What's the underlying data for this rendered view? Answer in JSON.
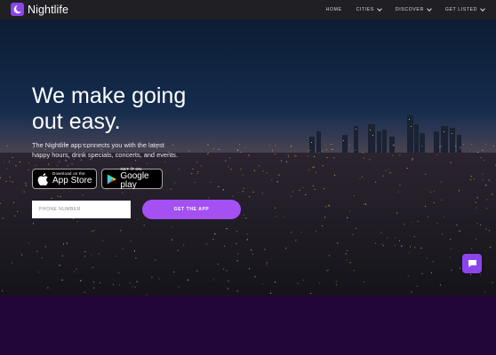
{
  "nav": {
    "brand": "Nightlife",
    "links": [
      {
        "label": "HOME",
        "dropdown": false
      },
      {
        "label": "CITIES",
        "dropdown": true
      },
      {
        "label": "DISCOVER",
        "dropdown": true
      },
      {
        "label": "GET LISTED",
        "dropdown": true
      }
    ]
  },
  "hero": {
    "headline_line1": "We make going",
    "headline_line2": "out easy.",
    "subtext": "The Nightlife app connects you with the latest happy hours, drink specials, concerts, and events.",
    "app_store": {
      "small": "Download on the",
      "big": "App Store"
    },
    "google_play": {
      "small": "GET IT ON",
      "big": "Google play"
    },
    "phone_placeholder": "PHONE NUMBER",
    "cta_label": "GET THE APP"
  },
  "colors": {
    "accent": "#a450f2",
    "brand": "#8e44ec",
    "nav_bg": "#1f1f24",
    "footer_band": "#22063a"
  },
  "icons": [
    "moon-logo-icon",
    "apple-icon",
    "google-play-icon",
    "chat-icon",
    "chevron-down-icon"
  ]
}
